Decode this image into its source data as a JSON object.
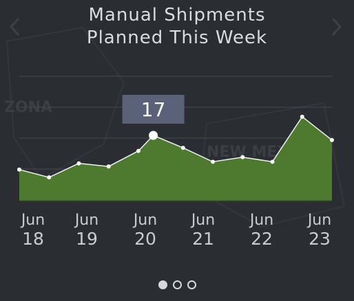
{
  "header": {
    "title_line1": "Manual Shipments",
    "title_line2": "Planned This Week"
  },
  "nav": {
    "prev_icon": "chevron-left-icon",
    "next_icon": "chevron-right-icon"
  },
  "background": {
    "map_labels": [
      "ZONA",
      "NEW MEXICO"
    ]
  },
  "pager": {
    "count": 3,
    "active": 0
  },
  "colors": {
    "background": "#2a2d31",
    "area_fill": "#4e7a2f",
    "line": "#f2f2f2",
    "tooltip_bg": "#5a6278",
    "text": "#d9dce0"
  },
  "chart_data": {
    "type": "area",
    "title": "Manual Shipments Planned This Week",
    "points": [
      {
        "x": "Jun 18 00:00",
        "y": 10
      },
      {
        "x": "Jun 18 12:00",
        "y": 7.5
      },
      {
        "x": "Jun 19 00:00",
        "y": 12
      },
      {
        "x": "Jun 19 12:00",
        "y": 11
      },
      {
        "x": "Jun 20 00:00",
        "y": 16
      },
      {
        "x": "Jun 20 06:00",
        "y": 21
      },
      {
        "x": "Jun 20 18:00",
        "y": 17
      },
      {
        "x": "Jun 21 06:00",
        "y": 12.5
      },
      {
        "x": "Jun 21 18:00",
        "y": 14
      },
      {
        "x": "Jun 22 06:00",
        "y": 12.5
      },
      {
        "x": "Jun 22 18:00",
        "y": 27
      },
      {
        "x": "Jun 23 06:00",
        "y": 19.5
      }
    ],
    "highlight_index": 5,
    "tooltip_value": "17",
    "x_ticks": [
      {
        "month": "Jun",
        "day": "18"
      },
      {
        "month": "Jun",
        "day": "19"
      },
      {
        "month": "Jun",
        "day": "20"
      },
      {
        "month": "Jun",
        "day": "21"
      },
      {
        "month": "Jun",
        "day": "22"
      },
      {
        "month": "Jun",
        "day": "23"
      }
    ],
    "ylim": [
      0,
      40
    ],
    "grid": true,
    "legend": "none"
  }
}
